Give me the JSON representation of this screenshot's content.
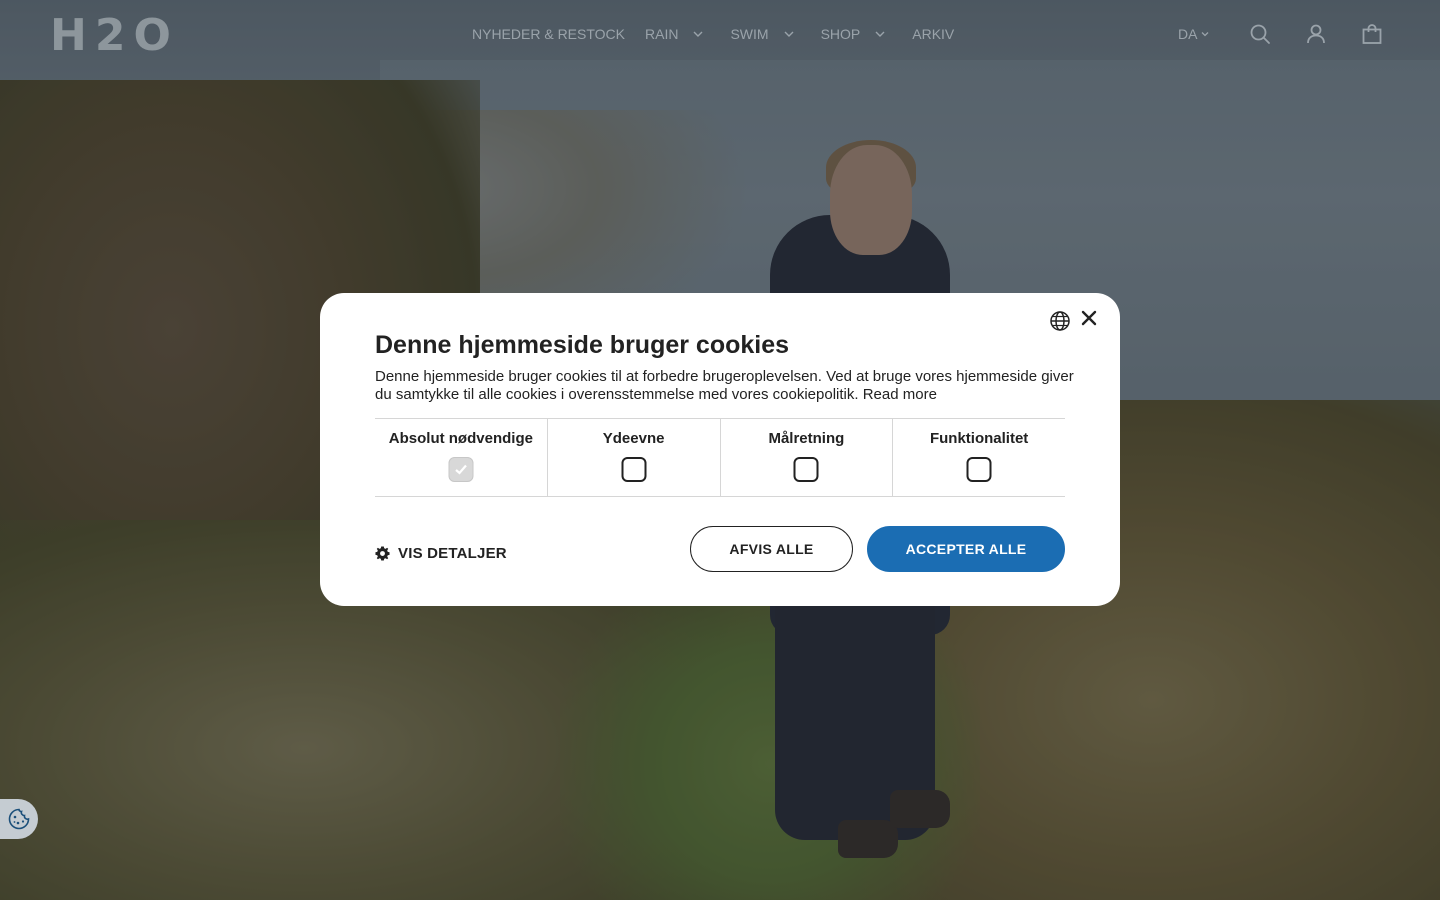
{
  "header": {
    "logo": "H2O",
    "nav": [
      {
        "label": "NYHEDER & RESTOCK"
      },
      {
        "label": "RAIN"
      },
      {
        "label": "SWIM"
      },
      {
        "label": "SHOP"
      },
      {
        "label": "ARKIV"
      }
    ],
    "language": "DA"
  },
  "cookie_modal": {
    "title": "Denne hjemmeside bruger cookies",
    "description": "Denne hjemmeside bruger cookies til at forbedre brugeroplevelsen. Ved at bruge vores hjemmeside giver du samtykke til alle cookies i overensstemmelse med vores cookiepolitik.",
    "read_more": "Read more",
    "categories": [
      {
        "label": "Absolut nødvendige",
        "checked": true
      },
      {
        "label": "Ydeevne",
        "checked": false
      },
      {
        "label": "Målretning",
        "checked": false
      },
      {
        "label": "Funktionalitet",
        "checked": false
      }
    ],
    "details_label": "VIS DETALJER",
    "decline_label": "AFVIS ALLE",
    "accept_label": "ACCEPTER ALLE"
  },
  "colors": {
    "accent": "#1b6db3",
    "header_text": "#9aa3aa"
  }
}
